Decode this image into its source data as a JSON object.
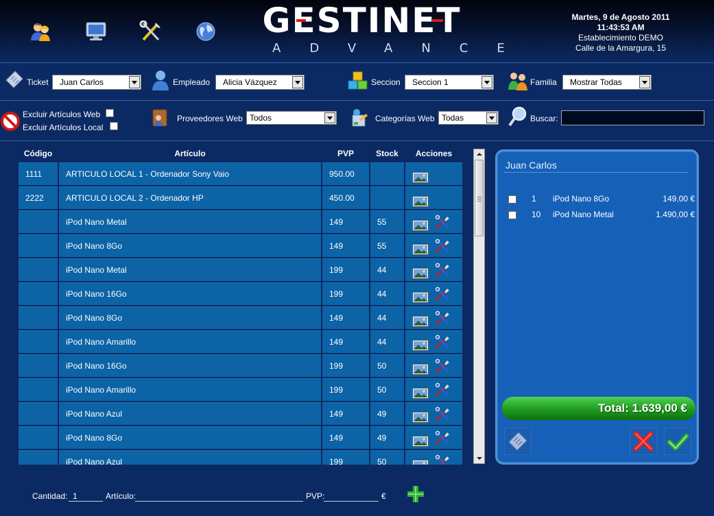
{
  "header": {
    "logo_main": "GESTINET",
    "logo_sub": "ADVANCE",
    "date": "Martes, 9 de Agosto 2011",
    "time": "11:43:53 AM",
    "establishment": "Establecimiento DEMO",
    "address": "Calle de la Amargura, 15",
    "icons": [
      "users-icon",
      "monitor-icon",
      "tools-icon",
      "globe-icon"
    ]
  },
  "filters": {
    "ticket_label": "Ticket",
    "ticket_value": "Juan Carlos",
    "employee_label": "Empleado",
    "employee_value": "Alicia Vázquez",
    "section_label": "Seccion",
    "section_value": "Seccion 1",
    "family_label": "Familia",
    "family_value": "Mostrar Todas",
    "exclude_web_label": "Excluir Artículos Web",
    "exclude_local_label": "Excluir Artículos Local",
    "providers_label": "Proveedores Web",
    "providers_value": "Todos",
    "categories_label": "Categorías Web",
    "categories_value": "Todas",
    "search_label": "Buscar:",
    "search_value": ""
  },
  "table": {
    "headers": {
      "code": "Código",
      "article": "Artículo",
      "pvp": "PVP",
      "stock": "Stock",
      "actions": "Acciones"
    },
    "rows": [
      {
        "code": "1111",
        "article": "ARTICULO LOCAL 1 - Ordenador Sony Vaio",
        "pvp": "950.00",
        "stock": "",
        "tool": false
      },
      {
        "code": "2222",
        "article": "ARTICULO LOCAL 2 - Ordenador HP",
        "pvp": "450.00",
        "stock": "",
        "tool": false
      },
      {
        "code": "",
        "article": "iPod Nano Metal",
        "pvp": "149",
        "stock": "55",
        "tool": true
      },
      {
        "code": "",
        "article": "iPod Nano 8Go",
        "pvp": "149",
        "stock": "55",
        "tool": true
      },
      {
        "code": "",
        "article": "iPod Nano Metal",
        "pvp": "199",
        "stock": "44",
        "tool": true
      },
      {
        "code": "",
        "article": "iPod Nano 16Go",
        "pvp": "199",
        "stock": "44",
        "tool": true
      },
      {
        "code": "",
        "article": "iPod Nano 8Go",
        "pvp": "149",
        "stock": "44",
        "tool": true
      },
      {
        "code": "",
        "article": "iPod Nano Amarillo",
        "pvp": "149",
        "stock": "44",
        "tool": true
      },
      {
        "code": "",
        "article": "iPod Nano 16Go",
        "pvp": "199",
        "stock": "50",
        "tool": true
      },
      {
        "code": "",
        "article": "iPod Nano Amarillo",
        "pvp": "199",
        "stock": "50",
        "tool": true
      },
      {
        "code": "",
        "article": "iPod Nano Azul",
        "pvp": "149",
        "stock": "49",
        "tool": true
      },
      {
        "code": "",
        "article": "iPod Nano 8Go",
        "pvp": "149",
        "stock": "49",
        "tool": true
      },
      {
        "code": "",
        "article": "iPod Nano Azul",
        "pvp": "199",
        "stock": "50",
        "tool": true
      }
    ]
  },
  "ticket": {
    "title": "Juan Carlos",
    "lines": [
      {
        "qty": "1",
        "name": "iPod Nano 8Go",
        "price": "149,00 €"
      },
      {
        "qty": "10",
        "name": "iPod Nano Metal",
        "price": "1.490,00 €"
      }
    ],
    "total": "Total: 1.639,00 €"
  },
  "bottom": {
    "qty_label": "Cantidad:",
    "qty_value": "1",
    "article_label": "Artículo:",
    "article_value": "",
    "pvp_label": "PVP:",
    "pvp_value": "",
    "currency": "€"
  },
  "colors": {
    "accent_red": "#e01818",
    "row_blue": "#0c63a6",
    "total_green": "#1f9a1f"
  }
}
